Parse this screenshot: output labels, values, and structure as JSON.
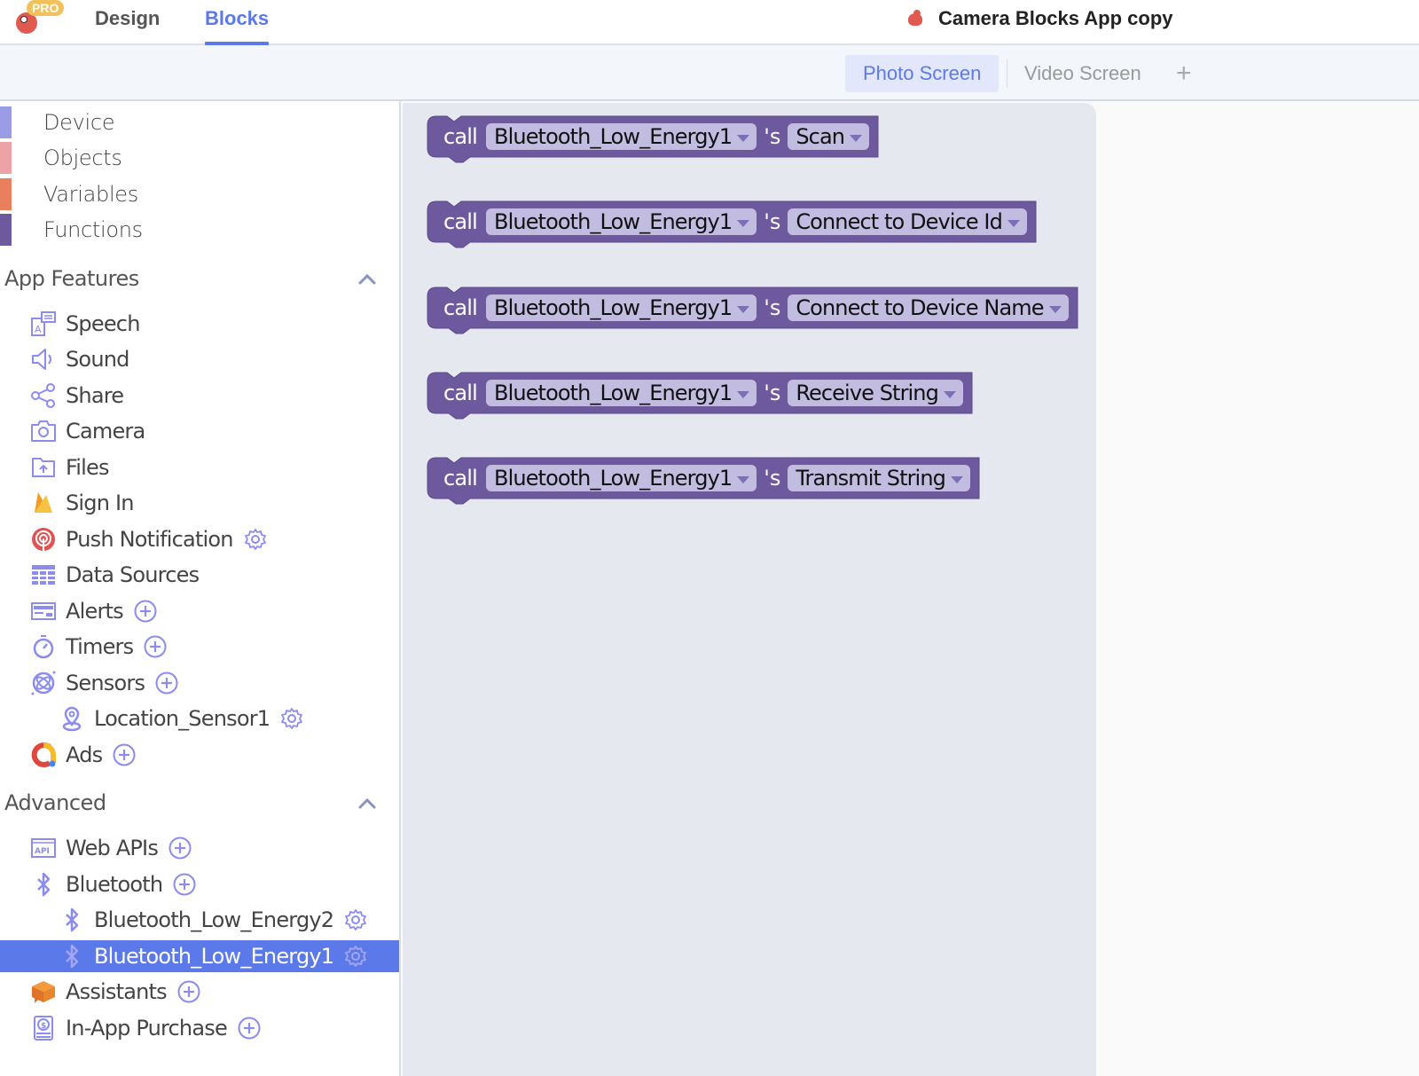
{
  "header": {
    "pro_badge": "PRO",
    "tabs": [
      {
        "label": "Design",
        "active": false
      },
      {
        "label": "Blocks",
        "active": true
      }
    ],
    "app_title": "Camera Blocks App copy"
  },
  "screens": {
    "tabs": [
      {
        "label": "Photo Screen",
        "active": true
      },
      {
        "label": "Video Screen",
        "active": false
      }
    ],
    "add_label": "+"
  },
  "sidebar": {
    "categories": [
      {
        "label": "Device",
        "color": "#9b9ce6"
      },
      {
        "label": "Objects",
        "color": "#eda3a5"
      },
      {
        "label": "Variables",
        "color": "#e8805e"
      },
      {
        "label": "Functions",
        "color": "#6d5a9e"
      }
    ],
    "app_features": {
      "title": "App Features",
      "items": [
        {
          "label": "Speech",
          "icon": "speech-icon"
        },
        {
          "label": "Sound",
          "icon": "sound-icon"
        },
        {
          "label": "Share",
          "icon": "share-icon"
        },
        {
          "label": "Camera",
          "icon": "camera-icon"
        },
        {
          "label": "Files",
          "icon": "files-icon"
        },
        {
          "label": "Sign In",
          "icon": "firebase-icon"
        },
        {
          "label": "Push Notification",
          "icon": "push-notification-icon",
          "action": "settings"
        },
        {
          "label": "Data Sources",
          "icon": "table-icon"
        },
        {
          "label": "Alerts",
          "icon": "alert-icon",
          "action": "add"
        },
        {
          "label": "Timers",
          "icon": "timer-icon",
          "action": "add"
        },
        {
          "label": "Sensors",
          "icon": "sensor-icon",
          "action": "add"
        },
        {
          "label": "Location_Sensor1",
          "icon": "location-icon",
          "action": "settings",
          "child": true
        },
        {
          "label": "Ads",
          "icon": "ads-icon",
          "action": "add"
        }
      ]
    },
    "advanced": {
      "title": "Advanced",
      "items": [
        {
          "label": "Web APIs",
          "icon": "api-icon",
          "action": "add"
        },
        {
          "label": "Bluetooth",
          "icon": "bluetooth-icon",
          "action": "add"
        },
        {
          "label": "Bluetooth_Low_Energy2",
          "icon": "bluetooth-icon",
          "action": "settings",
          "child": true
        },
        {
          "label": "Bluetooth_Low_Energy1",
          "icon": "bluetooth-icon",
          "action": "settings",
          "child": true,
          "selected": true
        },
        {
          "label": "Assistants",
          "icon": "assistant-icon",
          "action": "add"
        },
        {
          "label": "In-App Purchase",
          "icon": "purchase-icon",
          "action": "add"
        }
      ]
    }
  },
  "workspace": {
    "block_color": "#6d5a9e",
    "field_color": "#c3bce1",
    "blocks": [
      {
        "keyword": "call",
        "component": "Bluetooth_Low_Energy1",
        "possessive": "'s",
        "method": "Scan"
      },
      {
        "keyword": "call",
        "component": "Bluetooth_Low_Energy1",
        "possessive": "'s",
        "method": "Connect to Device Id"
      },
      {
        "keyword": "call",
        "component": "Bluetooth_Low_Energy1",
        "possessive": "'s",
        "method": "Connect to Device Name"
      },
      {
        "keyword": "call",
        "component": "Bluetooth_Low_Energy1",
        "possessive": "'s",
        "method": "Receive String"
      },
      {
        "keyword": "call",
        "component": "Bluetooth_Low_Energy1",
        "possessive": "'s",
        "method": "Transmit String"
      }
    ]
  }
}
